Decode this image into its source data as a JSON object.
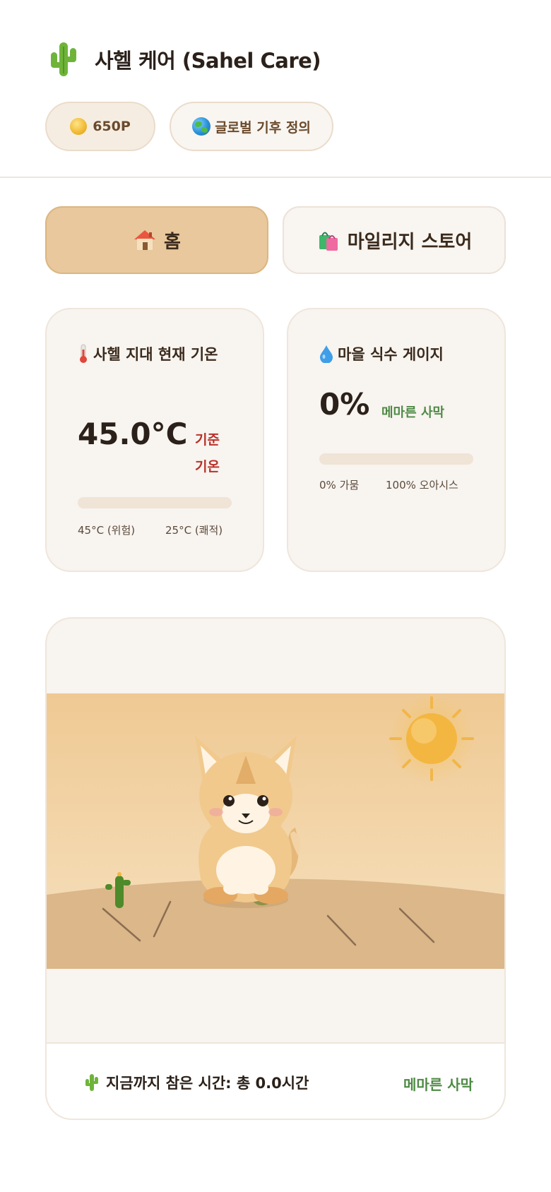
{
  "app": {
    "title": "사헬 케어 (Sahel Care)"
  },
  "chips": {
    "points": "650P",
    "climate": "글로벌 기후 정의"
  },
  "tabs": {
    "home": "홈",
    "store": "마일리지 스토어"
  },
  "temperature_card": {
    "title": "사헬 지대 현재 기온",
    "value": "45.0°C",
    "status": "기준 기온",
    "level_percent": 0,
    "range_left": "45°C (위험)",
    "range_right": "25°C (쾌적)"
  },
  "water_card": {
    "title": "마을 식수 게이지",
    "value": "0%",
    "status": "메마른 사막",
    "level_percent": 0,
    "range_left": "0% 가뭄",
    "range_right": "100% 오아시스"
  },
  "footer": {
    "total_time": "지금까지 참은 시간: 총 0.0시간",
    "stage": "메마른 사막"
  },
  "colors": {
    "accent": "#e8c89c",
    "danger": "#b8322a",
    "success": "#4e8a45",
    "card_bg": "#f8f4f0"
  },
  "icons": {
    "logo": "cactus-icon",
    "points": "coin-icon",
    "climate": "globe-icon",
    "home": "house-icon",
    "store": "shopping-bags-icon",
    "temperature": "thermometer-icon",
    "water": "droplet-icon"
  }
}
